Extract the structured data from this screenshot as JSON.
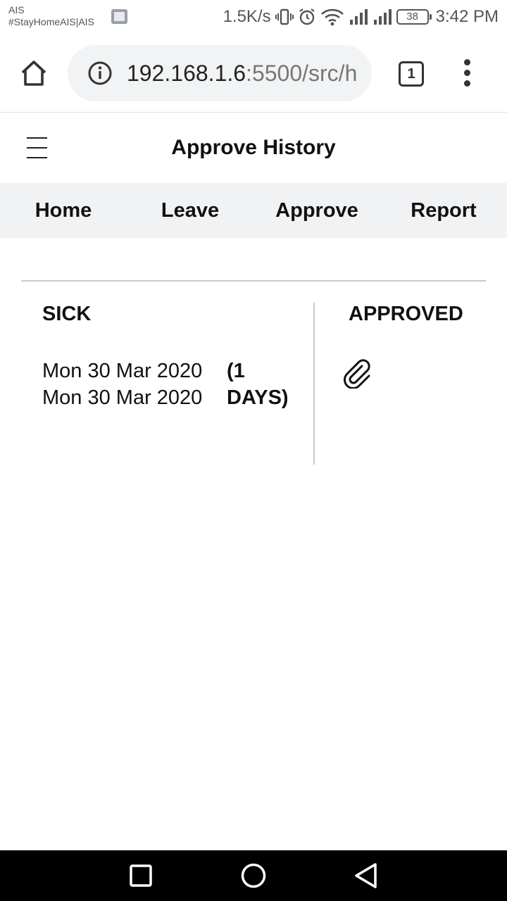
{
  "status_bar": {
    "carrier": "AIS",
    "carrier_tag": "#StayHomeAIS|AIS",
    "net_speed": "1.5K/s",
    "battery": "38",
    "time": "3:42 PM"
  },
  "browser": {
    "url_host": "192.168.1.6",
    "url_rest": ":5500/src/h",
    "tab_count": "1"
  },
  "header": {
    "title": "Approve History"
  },
  "nav": {
    "items": [
      {
        "label": "Home"
      },
      {
        "label": "Leave"
      },
      {
        "label": "Approve"
      },
      {
        "label": "Report"
      }
    ]
  },
  "records": [
    {
      "type": "SICK",
      "start_date": "Mon 30 Mar 2020",
      "end_date": "Mon 30 Mar 2020",
      "duration": "(1 DAYS)",
      "status": "APPROVED",
      "attachment_icon": "paperclip-icon"
    }
  ]
}
